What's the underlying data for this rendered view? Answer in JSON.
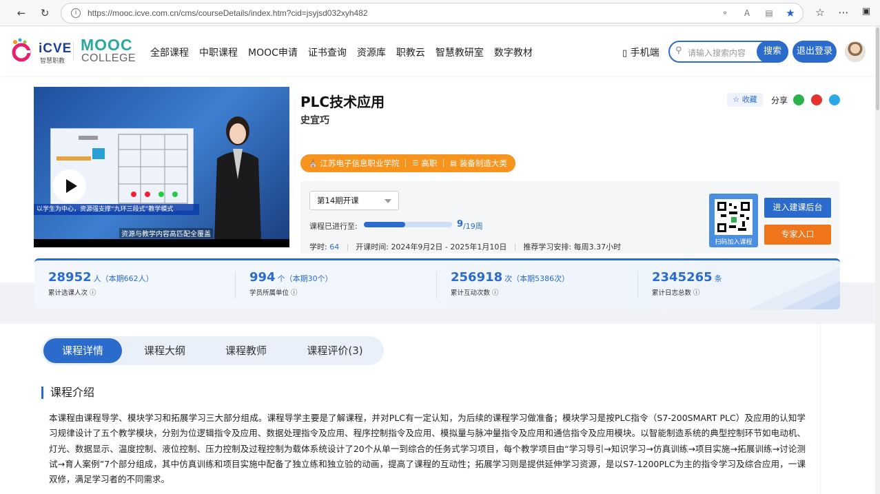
{
  "browser": {
    "url": "https://mooc.icve.com.cn/cms/courseDetails/index.htm?cid=jsyjsd032xyh482"
  },
  "header": {
    "logo_icve": "iCVE",
    "logo_icve_sub": "智慧职教",
    "logo_mooc": "MOOC",
    "logo_college": "COLLEGE",
    "nav": [
      "全部课程",
      "中职课程",
      "MOOC申请",
      "证书查询",
      "资源库",
      "职教云",
      "智慧教研室",
      "数字教材"
    ],
    "mobile_label": "手机端",
    "search_placeholder": "请输入搜索内容",
    "search_button": "搜索",
    "logout_button": "退出登录"
  },
  "video": {
    "banner_text": "以学生为中心，资源强支撑“九环三段式”教学模式",
    "caption_text": "资源与教学内容高匹配全覆盖"
  },
  "course": {
    "title": "PLC技术应用",
    "teacher": "史宜巧",
    "favorite_label": "收藏",
    "share_label": "分享",
    "tags": [
      "江苏电子信息职业学院",
      "高职",
      "装备制造大类"
    ],
    "term_select": "第14期开课",
    "progress_label": "课程已进行至:",
    "progress_current": "9",
    "progress_total": "/19周",
    "progress_fraction": 0.47,
    "hours_label": "学时:",
    "hours_value": "64",
    "period_label": "开课时间:",
    "period_value": "2024年9月2日 - 2025年1月10日",
    "schedule_label": "推荐学习安排:",
    "schedule_value": "每周3.37小时",
    "qr_caption": "扫码加入课程",
    "btn_backend": "进入建课后台",
    "btn_expert": "专家入口"
  },
  "stats": [
    {
      "num": "28952",
      "unit": "人（本期662人）",
      "label": "累计选课人次"
    },
    {
      "num": "994",
      "unit": "个（本期30个）",
      "label": "学员所属单位"
    },
    {
      "num": "256918",
      "unit": "次（本期5386次）",
      "label": "累计互动次数"
    },
    {
      "num": "2345265",
      "unit": "条",
      "label": "累计日志总数"
    }
  ],
  "tabs": [
    "课程详情",
    "课程大纲",
    "课程教师",
    "课程评价(3)"
  ],
  "section": {
    "title": "课程介绍",
    "description": "本课程由课程导学、模块学习和拓展学习三大部分组成。课程导学主要是了解课程，并对PLC有一定认知，为后续的课程学习做准备；模块学习是按PLC指令（S7-200SMART PLC）及应用的认知学习规律设计了五个教学模块，分别为位逻辑指令及应用、数据处理指令及应用、程序控制指令及应用、模拟量与脉冲量指令及应用和通信指令及应用模块。以智能制造系统的典型控制环节如电动机、灯光、数据显示、温度控制、液位控制、压力控制及过程控制为载体系统设计了20个从单一到综合的任务式学习项目，每个教学项目由“学习导引→知识学习→仿真训练→项目实施→拓展训练→讨论测试→育人案例”7个部分组成，其中仿真训练和项目实施中配备了独立练和独立验的动画，提高了课程的互动性；拓展学习则是提供延伸学习资源，是以S7-1200PLC为主的指令学习及综合应用，一课双修，满足学习者的不同需求。"
  },
  "colors": {
    "primary": "#2a6bcc",
    "orange": "#f7941d"
  }
}
